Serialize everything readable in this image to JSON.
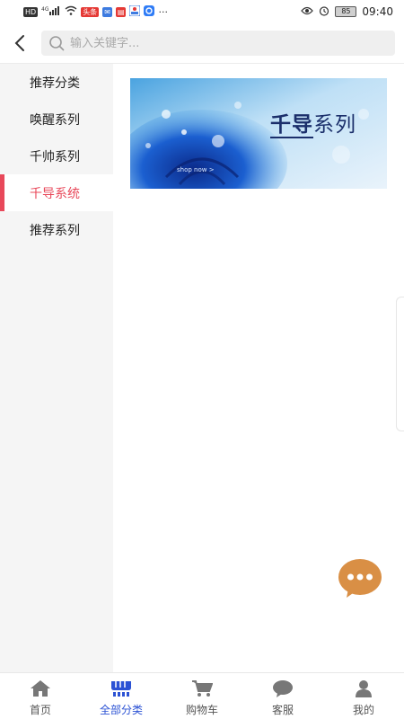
{
  "status_bar": {
    "hd": "HD",
    "signal": "4G",
    "time": "09:40",
    "battery": "85",
    "more": "···",
    "notify_red_1": "头条",
    "icon_names": [
      "hd-icon",
      "signal-icon",
      "wifi-icon",
      "app-notify-icon",
      "mail-icon",
      "news-icon",
      "app-icon",
      "eye-icon",
      "alarm-icon",
      "battery-icon"
    ]
  },
  "header": {
    "search_placeholder": "输入关键字..."
  },
  "sidebar": {
    "items": [
      {
        "label": "推荐分类",
        "active": false
      },
      {
        "label": "唤醒系列",
        "active": false
      },
      {
        "label": "千帅系列",
        "active": false
      },
      {
        "label": "千导系统",
        "active": true
      },
      {
        "label": "推荐系列",
        "active": false
      }
    ]
  },
  "banner": {
    "title_bold": "千导",
    "title_rest": "系列",
    "shop_text": "shop now >"
  },
  "bottom_nav": {
    "items": [
      {
        "label": "首页",
        "icon": "home-icon",
        "active": false
      },
      {
        "label": "全部分类",
        "icon": "category-icon",
        "active": true
      },
      {
        "label": "购物车",
        "icon": "cart-icon",
        "active": false
      },
      {
        "label": "客服",
        "icon": "chat-bubble-icon",
        "active": false
      },
      {
        "label": "我的",
        "icon": "user-icon",
        "active": false
      }
    ]
  },
  "colors": {
    "accent_red": "#e8485a",
    "nav_active": "#2b52d4",
    "chat_fab": "#d98f45",
    "sidebar_bg": "#f5f5f5"
  }
}
